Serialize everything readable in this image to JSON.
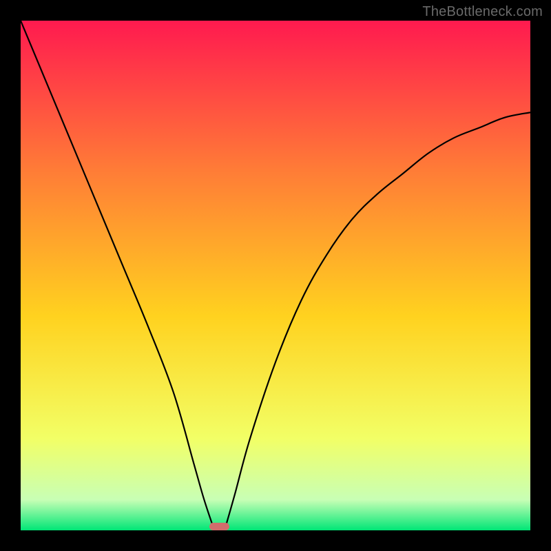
{
  "watermark": "TheBottleneck.com",
  "colors": {
    "frame": "#000000",
    "curve": "#000000",
    "marker": "#d16d6c",
    "watermark_text": "#6a6a6a",
    "gradient_top": "#ff1a4f",
    "gradient_mid_upper": "#ff7e36",
    "gradient_mid": "#ffd21f",
    "gradient_lower": "#f2ff66",
    "gradient_pale": "#c8ffb5",
    "gradient_bottom": "#00e676"
  },
  "chart_data": {
    "type": "line",
    "title": "",
    "xlabel": "",
    "ylabel": "",
    "xlim": [
      0,
      100
    ],
    "ylim": [
      0,
      100
    ],
    "x": [
      0,
      5,
      10,
      15,
      20,
      25,
      30,
      34,
      36,
      38,
      40,
      42,
      45,
      50,
      55,
      60,
      65,
      70,
      75,
      80,
      85,
      90,
      95,
      100
    ],
    "series": [
      {
        "name": "left-branch",
        "x": [
          0,
          5,
          10,
          15,
          20,
          25,
          30,
          34,
          36,
          38
        ],
        "values": [
          100,
          88,
          76,
          64,
          52,
          40,
          27,
          13,
          6,
          0
        ]
      },
      {
        "name": "right-branch",
        "x": [
          40,
          42,
          45,
          50,
          55,
          60,
          65,
          70,
          75,
          80,
          85,
          90,
          95,
          100
        ],
        "values": [
          0,
          7,
          18,
          33,
          45,
          54,
          61,
          66,
          70,
          74,
          77,
          79,
          81,
          82
        ]
      }
    ],
    "marker": {
      "x": 39,
      "y": 0,
      "width": 4,
      "height": 1.5
    },
    "annotations": []
  }
}
